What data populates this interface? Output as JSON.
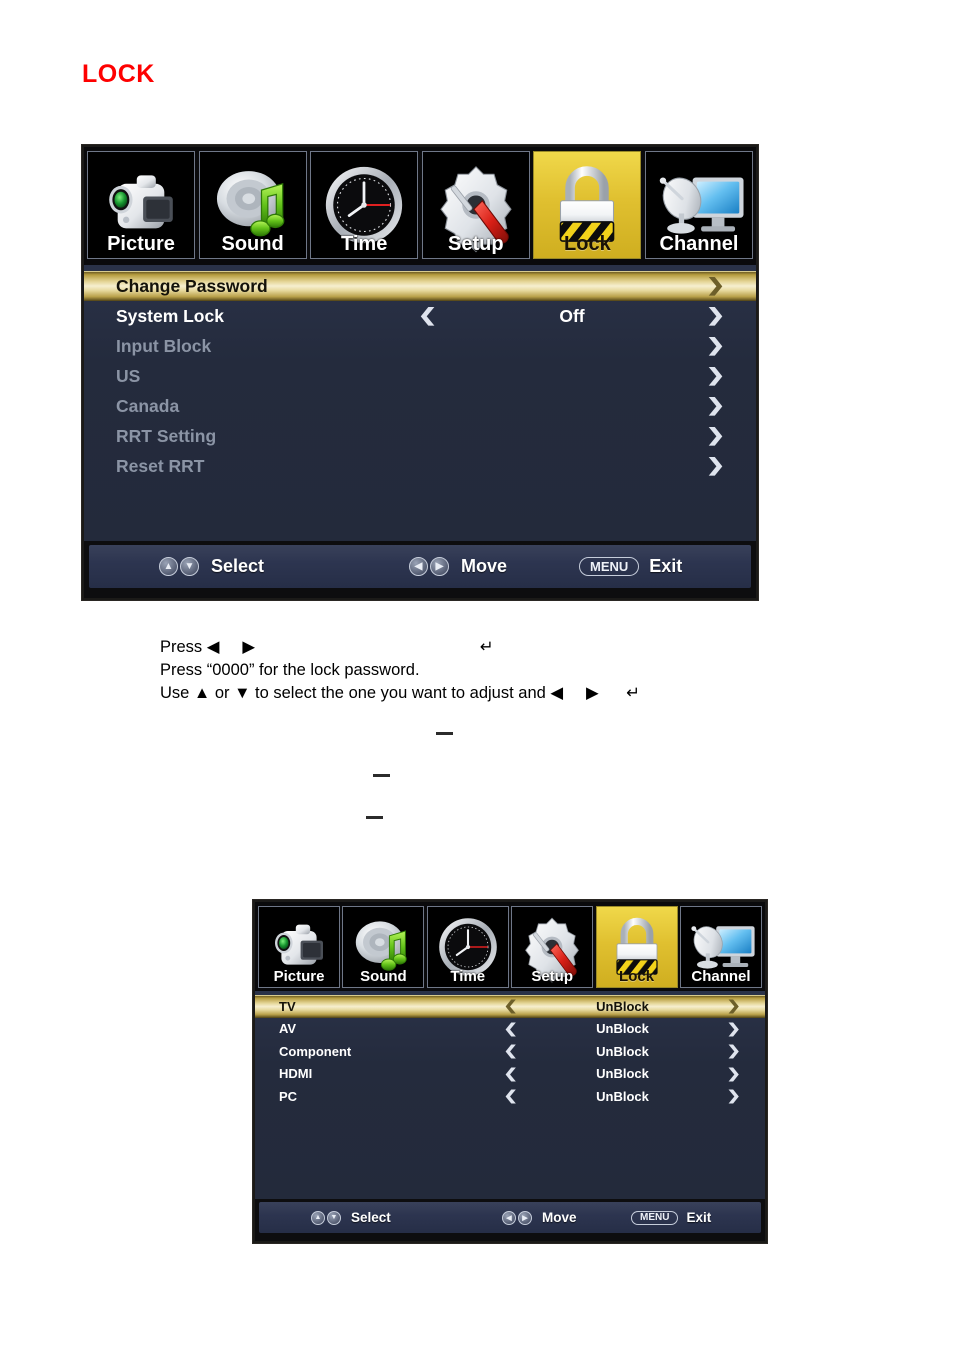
{
  "page": {
    "title": "LOCK"
  },
  "icon_bar": {
    "items": [
      {
        "label": "Picture",
        "icon": "camcorder-icon",
        "active": false
      },
      {
        "label": "Sound",
        "icon": "speaker-music-note-icon",
        "active": false
      },
      {
        "label": "Time",
        "icon": "clock-icon",
        "active": false
      },
      {
        "label": "Setup",
        "icon": "gear-screwdriver-icon",
        "active": false
      },
      {
        "label": "Lock",
        "icon": "padlock-icon",
        "active": true
      },
      {
        "label": "Channel",
        "icon": "satellite-dish-monitor-icon",
        "active": false
      }
    ]
  },
  "lock_menu": {
    "rows": [
      {
        "label": "Change Password",
        "value": "",
        "highlighted": true,
        "dimmed": false,
        "left_arrow": false,
        "right_arrow": true
      },
      {
        "label": "System Lock",
        "value": "Off",
        "highlighted": false,
        "dimmed": false,
        "left_arrow": true,
        "right_arrow": true
      },
      {
        "label": "Input Block",
        "value": "",
        "highlighted": false,
        "dimmed": true,
        "left_arrow": false,
        "right_arrow": true
      },
      {
        "label": "US",
        "value": "",
        "highlighted": false,
        "dimmed": true,
        "left_arrow": false,
        "right_arrow": true
      },
      {
        "label": "Canada",
        "value": "",
        "highlighted": false,
        "dimmed": true,
        "left_arrow": false,
        "right_arrow": true
      },
      {
        "label": "RRT Setting",
        "value": "",
        "highlighted": false,
        "dimmed": true,
        "left_arrow": false,
        "right_arrow": true
      },
      {
        "label": "Reset RRT",
        "value": "",
        "highlighted": false,
        "dimmed": true,
        "left_arrow": false,
        "right_arrow": true
      }
    ]
  },
  "input_block_menu": {
    "rows": [
      {
        "label": "TV",
        "value": "UnBlock",
        "highlighted": true,
        "dimmed": false,
        "left_arrow": true,
        "right_arrow": true
      },
      {
        "label": "AV",
        "value": "UnBlock",
        "highlighted": false,
        "dimmed": false,
        "left_arrow": true,
        "right_arrow": true
      },
      {
        "label": "Component",
        "value": "UnBlock",
        "highlighted": false,
        "dimmed": false,
        "left_arrow": true,
        "right_arrow": true
      },
      {
        "label": "HDMI",
        "value": "UnBlock",
        "highlighted": false,
        "dimmed": false,
        "left_arrow": true,
        "right_arrow": true
      },
      {
        "label": "PC",
        "value": "UnBlock",
        "highlighted": false,
        "dimmed": false,
        "left_arrow": true,
        "right_arrow": true
      }
    ]
  },
  "footer": {
    "select_label": "Select",
    "move_label": "Move",
    "menu_key_label": "MENU",
    "exit_label": "Exit",
    "up_glyph": "▲",
    "down_glyph": "▼",
    "left_glyph": "◀",
    "right_glyph": "▶"
  },
  "body_text": {
    "line1": "Press ◀     ▶                                                 ↵",
    "line2": "Press “0000” for the lock password.",
    "line3": "Use ▲ or ▼ to select the one you want to adjust and ◀     ▶      ↵"
  },
  "colors": {
    "title_red": "#fe0000",
    "panel_navy": "#242b3d",
    "highlight_gold": "#f6efcf",
    "active_tile_yellow": "#e0c030",
    "dim_text": "#8b94a5"
  }
}
